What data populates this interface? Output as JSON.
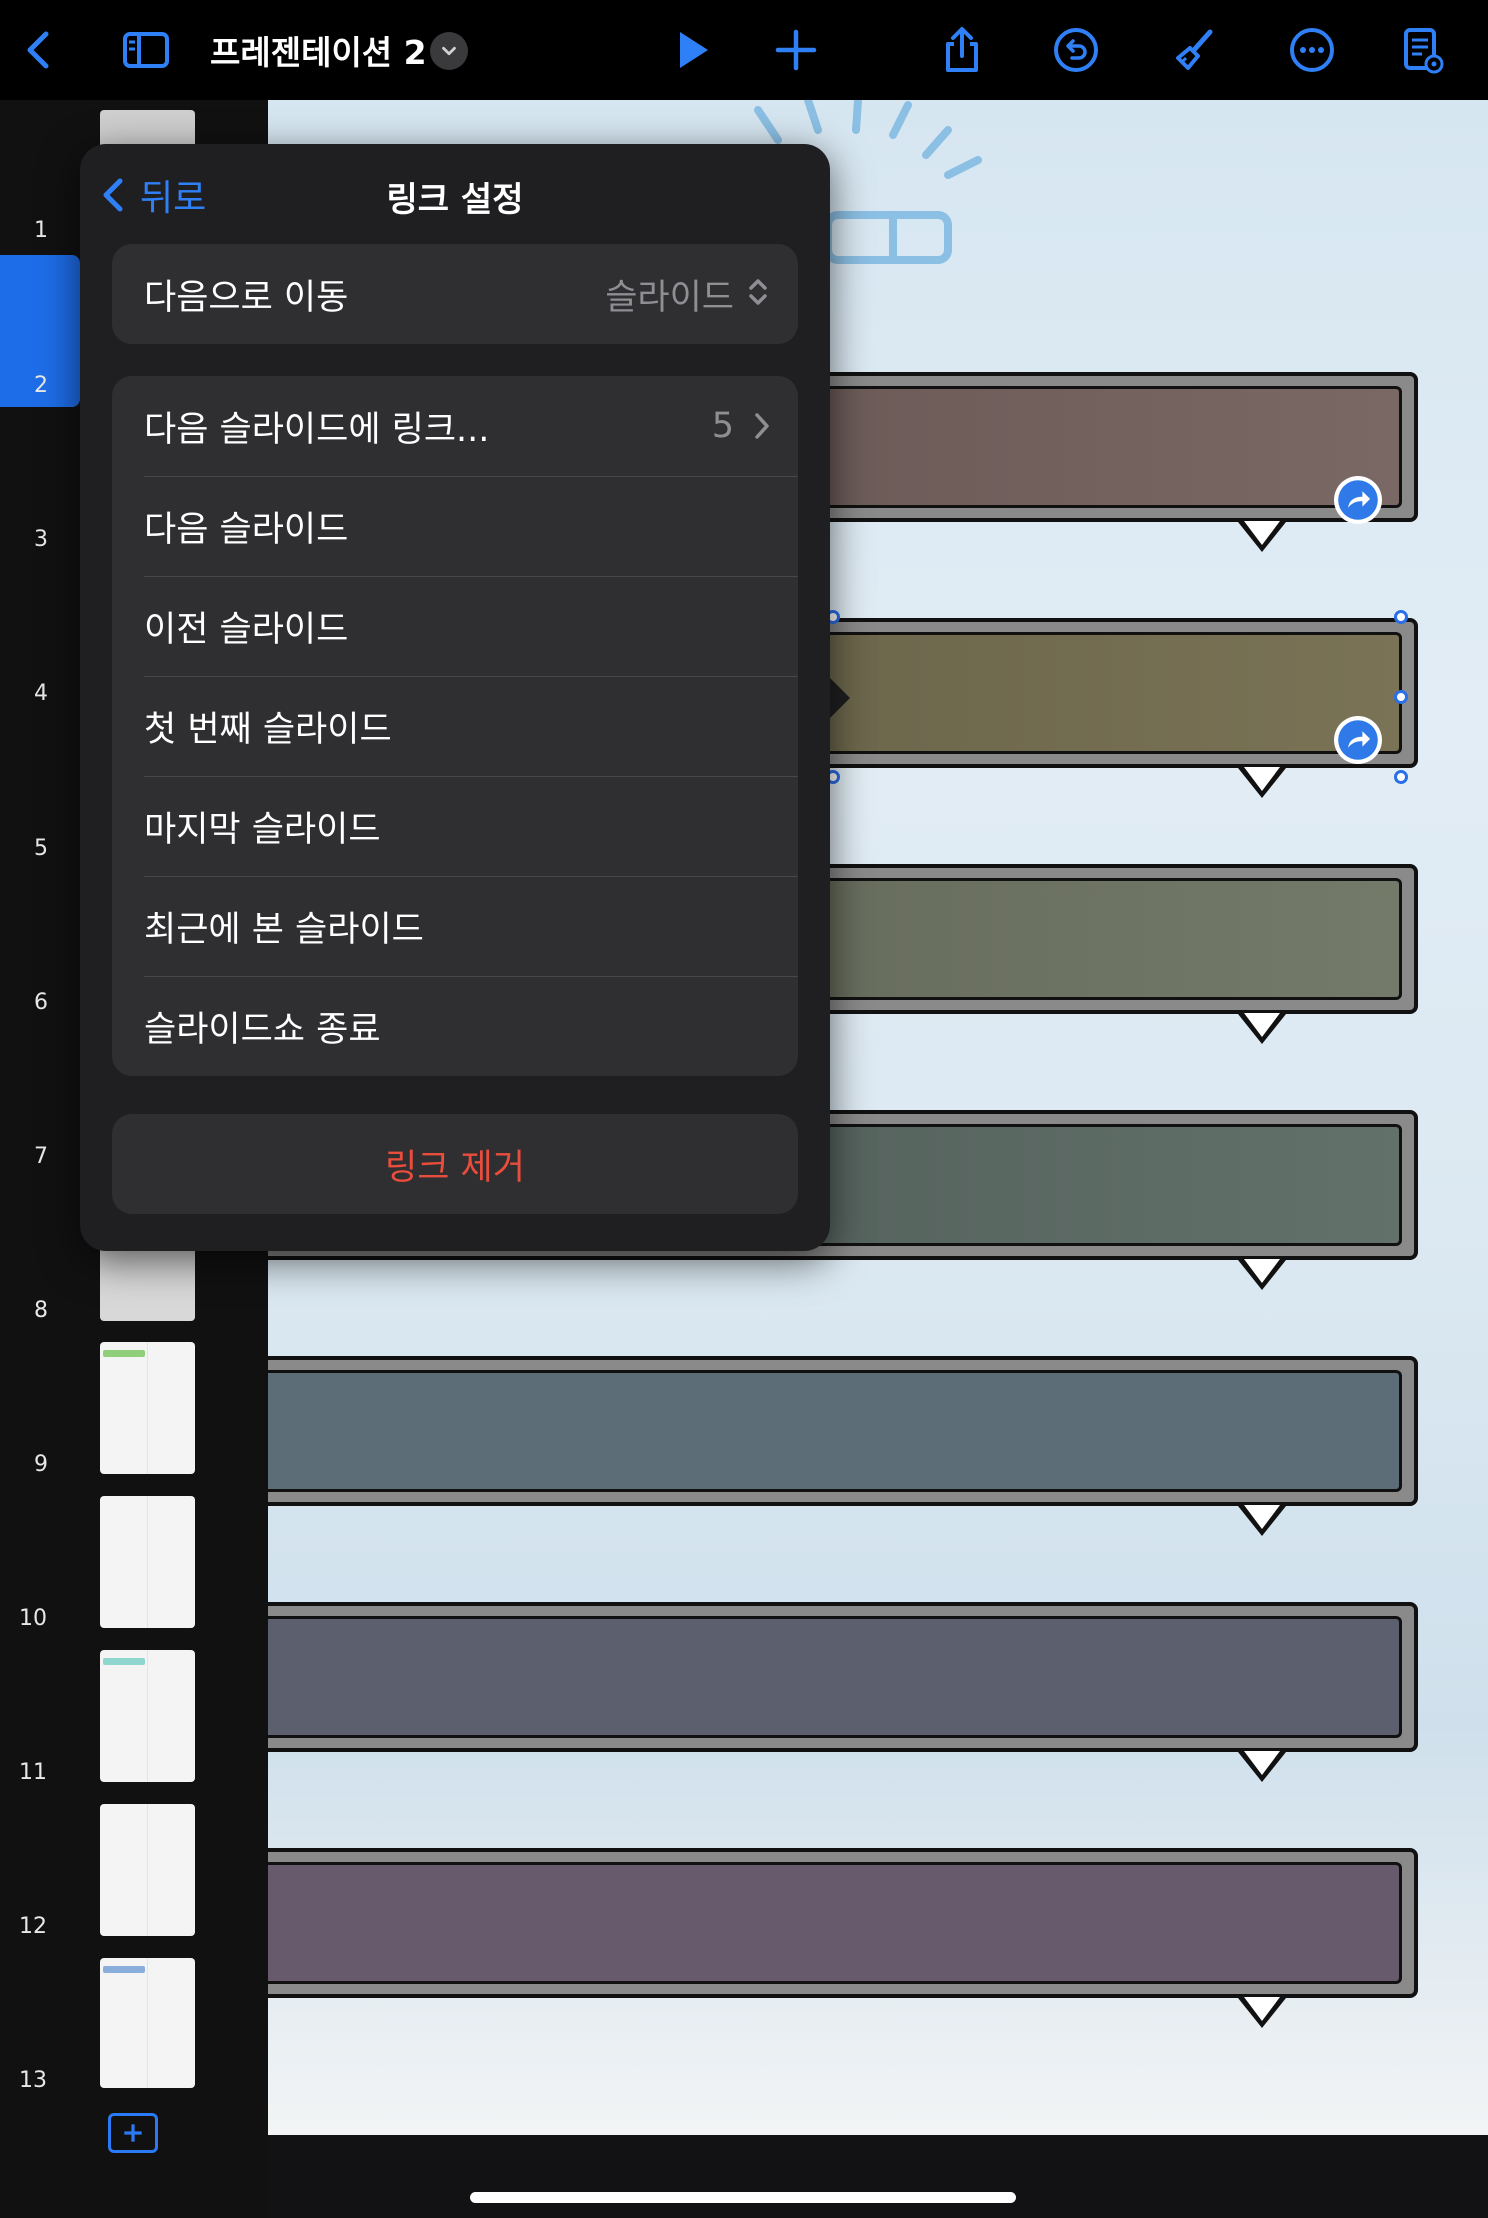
{
  "toolbar": {
    "title": "프레젠테이션 2",
    "icons": [
      "back-chevron-icon",
      "sidebar-icon",
      "chevron-down-icon",
      "play-icon",
      "plus-icon",
      "share-icon",
      "undo-icon",
      "paintbrush-icon",
      "more-icon",
      "presenter-notes-icon"
    ]
  },
  "sidebar": {
    "slides": [
      "1",
      "2",
      "3",
      "4",
      "5",
      "6",
      "7",
      "8",
      "9",
      "10",
      "11",
      "12",
      "13"
    ],
    "selected": "2"
  },
  "popover": {
    "back_label": "뒤로",
    "title": "링크 설정",
    "link_type": {
      "label": "다음으로 이동",
      "value": "슬라이드"
    },
    "options": [
      {
        "label": "다음 슬라이드에 링크...",
        "value": "5"
      },
      {
        "label": "다음 슬라이드"
      },
      {
        "label": "이전 슬라이드"
      },
      {
        "label": "첫 번째 슬라이드"
      },
      {
        "label": "마지막 슬라이드"
      },
      {
        "label": "최근에 본 슬라이드"
      },
      {
        "label": "슬라이드쇼 종료"
      }
    ],
    "remove_label": "링크 제거"
  },
  "colors": {
    "accent": "#2f80f6",
    "destructive": "#eb4d3d",
    "box_fills": [
      "#6f5c59",
      "#6f684f",
      "#6b7060",
      "#58665f",
      "#5c6d78",
      "#5c606e",
      "#665a6c"
    ]
  }
}
